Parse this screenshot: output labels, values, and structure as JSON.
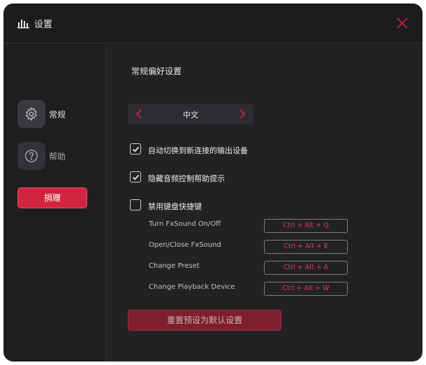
{
  "window": {
    "title": "设置"
  },
  "sidebar": {
    "items": [
      {
        "label": "常规",
        "icon": "gear-icon"
      },
      {
        "label": "帮助",
        "icon": "help-icon"
      }
    ],
    "donate_label": "捐赠"
  },
  "general": {
    "section_title": "常规偏好设置",
    "language": {
      "value": "中文"
    },
    "options": [
      {
        "label": "自动切换到新连接的输出设备",
        "checked": true
      },
      {
        "label": "隐藏音频控制帮助提示",
        "checked": true
      },
      {
        "label": "禁用键盘快捷键",
        "checked": false
      }
    ],
    "shortcuts": [
      {
        "label": "Turn FxSound On/Off",
        "keys": "Ctrl + Alt + Q"
      },
      {
        "label": "Open/Close FxSound",
        "keys": "Ctrl + Alt + E"
      },
      {
        "label": "Change Preset",
        "keys": "Ctrl + Alt + A"
      },
      {
        "label": "Change Playback Device",
        "keys": "Ctrl + Alt + W"
      }
    ],
    "reset_label": "重置预设为默认设置"
  },
  "colors": {
    "accent": "#d2243f",
    "background": "#222225",
    "shortcut_text": "#e03a55"
  }
}
